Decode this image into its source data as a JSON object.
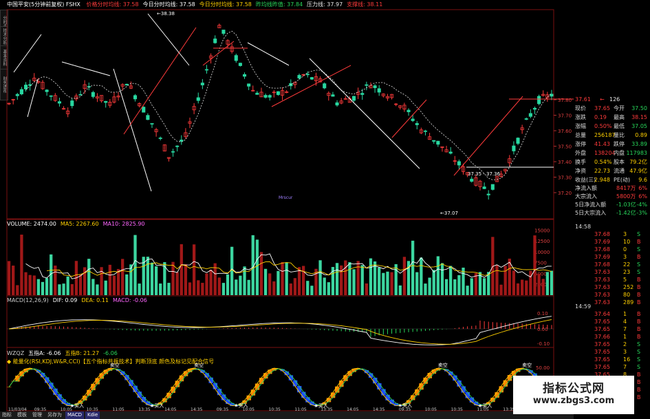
{
  "header": {
    "title": "中国平安(5分钟前复权) FSHX",
    "items": [
      {
        "label": "价格分时均线:",
        "value": "37.58",
        "color": "#ff3b3b"
      },
      {
        "label": "今日分时均线:",
        "value": "37.58",
        "color": "#ffffff"
      },
      {
        "label": "今日分时均线:",
        "value": "37.58",
        "color": "#ffd000"
      },
      {
        "label": "昨均线昨值:",
        "value": "37.84",
        "color": "#28d75a"
      },
      {
        "label": "压力线:",
        "value": "37.97",
        "color": "#e8e8e8"
      },
      {
        "label": "支撑线:",
        "value": "38.11",
        "color": "#ff3b3b"
      }
    ]
  },
  "left_tabs": [
    "分时走势",
    "技术分析",
    "基本资料",
    "财务透视"
  ],
  "price_chart": {
    "y_ticks": [
      "37.80",
      "37.70",
      "37.60",
      "37.50",
      "37.40",
      "37.30",
      "37.20"
    ],
    "high_label": "38.38",
    "low_label": "37.07",
    "range_label": "37.35 - 37.36",
    "marker_label": "Mrscur",
    "current_price": "37.61",
    "current_change": "126"
  },
  "volume": {
    "header": [
      {
        "text": "VOLUME: 2474.00",
        "color": "#ffffff"
      },
      {
        "text": "MA5: 2267.60",
        "color": "#ffd000"
      },
      {
        "text": "MA10: 2825.90",
        "color": "#ff66ff"
      }
    ],
    "y_ticks": [
      "15000",
      "12500",
      "10000",
      "7500",
      "5000",
      "2500"
    ]
  },
  "macd": {
    "header": [
      {
        "text": "MACD(12,26,9)",
        "color": "#cccccc"
      },
      {
        "text": "DIF: 0.09",
        "color": "#ffffff"
      },
      {
        "text": "DEA: 0.11",
        "color": "#ffd000"
      },
      {
        "text": "MACD: -0.06",
        "color": "#ff66ff"
      }
    ],
    "y_ticks": [
      "0.10",
      "0.00",
      "-0.10"
    ]
  },
  "wizqz": {
    "header": [
      {
        "text": "WZQZ",
        "color": "#cccccc"
      },
      {
        "text": "五指A: -6.06",
        "color": "#ffffff"
      },
      {
        "text": "五指B: 21.27",
        "color": "#ffd000"
      },
      {
        "text": "-6.06",
        "color": "#28d75a"
      }
    ],
    "note": "◆ 能量化(RSI,KDJ,W&R,CCI)【五个指标共振技术】判断顶底 颜色及标记见配合信号",
    "buy_label": "买入",
    "sell_label": "卖空",
    "y_ticks": [
      "50.00",
      "0.00"
    ]
  },
  "x_ticks": [
    "11/03/04",
    "09:35",
    "10:05",
    "10:35",
    "11:05",
    "13:35",
    "14:05",
    "14:35",
    "09:35",
    "10:05",
    "10:35",
    "11:05",
    "13:35",
    "14:05",
    "14:35",
    "09:35",
    "10:05",
    "10:35",
    "11:05",
    "13:35",
    "14:05"
  ],
  "quote": {
    "rows": [
      {
        "l1": "现价",
        "v1": "37.65",
        "c1": "#ff3b3b",
        "l2": "今开",
        "v2": "37.50",
        "c2": "#28d75a"
      },
      {
        "l1": "涨跌",
        "v1": "0.19",
        "c1": "#ff3b3b",
        "l2": "最高",
        "v2": "38.15",
        "c2": "#ff3b3b"
      },
      {
        "l1": "涨幅",
        "v1": "0.50%",
        "c1": "#ff3b3b",
        "l2": "最低",
        "v2": "37.05",
        "c2": "#28d75a"
      },
      {
        "l1": "总量",
        "v1": "256187",
        "c1": "#ffd000",
        "l2": "量比",
        "v2": "0.89",
        "c2": "#ffd000"
      },
      {
        "l1": "涨停",
        "v1": "41.43",
        "c1": "#ff3b3b",
        "l2": "跌停",
        "v2": "33.89",
        "c2": "#28d75a"
      },
      {
        "l1": "外盘",
        "v1": "138204",
        "c1": "#ff3b3b",
        "l2": "内盘",
        "v2": "117983",
        "c2": "#28d75a"
      },
      {
        "l1": "换手",
        "v1": "0.54%",
        "c1": "#ffd000",
        "l2": "股本",
        "v2": "79.2亿",
        "c2": "#ffd000"
      },
      {
        "l1": "净资",
        "v1": "22.73",
        "c1": "#ffd000",
        "l2": "流通",
        "v2": "47.9亿",
        "c2": "#ffd000"
      },
      {
        "l1": "收益(三)",
        "v1": "2.948",
        "c1": "#ffd000",
        "l2": "PE(动)",
        "v2": "9.6",
        "c2": "#ffd000"
      }
    ],
    "flows": [
      {
        "label": "净流入额",
        "value": "8417万",
        "pct": "6%",
        "color": "#ff3b3b"
      },
      {
        "label": "大宗流入",
        "value": "5800万",
        "pct": "6%",
        "color": "#ff3b3b"
      },
      {
        "label": "5日净流入额",
        "value": "-1.03亿",
        "pct": "-4%",
        "color": "#28d75a"
      },
      {
        "label": "5日大宗流入",
        "value": "-1.42亿",
        "pct": "-3%",
        "color": "#28d75a"
      }
    ]
  },
  "ticks1": {
    "time": "14:58",
    "rows": [
      {
        "p": "37.68",
        "v": "3",
        "s": "S"
      },
      {
        "p": "37.69",
        "v": "10",
        "s": "B"
      },
      {
        "p": "37.68",
        "v": "0",
        "s": "S"
      },
      {
        "p": "37.69",
        "v": "3",
        "s": "B"
      },
      {
        "p": "37.68",
        "v": "22",
        "s": "S"
      },
      {
        "p": "37.63",
        "v": "23",
        "s": "S"
      },
      {
        "p": "37.63",
        "v": "5",
        "s": "B"
      },
      {
        "p": "37.63",
        "v": "252",
        "s": "B"
      },
      {
        "p": "37.63",
        "v": "80",
        "s": "B"
      },
      {
        "p": "37.63",
        "v": "289",
        "s": "B"
      }
    ]
  },
  "ticks2": {
    "time": "14:59",
    "rows": [
      {
        "p": "37.64",
        "v": "1",
        "s": "B"
      },
      {
        "p": "37.65",
        "v": "4",
        "s": "B"
      },
      {
        "p": "37.65",
        "v": "7",
        "s": "B"
      },
      {
        "p": "37.66",
        "v": "1",
        "s": "B"
      },
      {
        "p": "37.65",
        "v": "2",
        "s": "S"
      },
      {
        "p": "37.65",
        "v": "3",
        "s": "S"
      },
      {
        "p": "37.65",
        "v": "16",
        "s": "S"
      },
      {
        "p": "37.65",
        "v": "7",
        "s": "S"
      },
      {
        "p": "37.65",
        "v": "8",
        "s": "B"
      },
      {
        "p": "37.65",
        "v": "10",
        "s": "B"
      },
      {
        "p": "37.65",
        "v": "4",
        "s": "B"
      },
      {
        "p": "37.65",
        "v": "5",
        "s": "B"
      }
    ]
  },
  "tabs": [
    "指标",
    "模板",
    "管理",
    "另存为",
    "MACD",
    "Kdie"
  ],
  "watermark": {
    "title": "指标公式网",
    "url": "www.zbgs3.com"
  },
  "colors": {
    "up": "#ff3b3b",
    "down": "#28d7a0",
    "grid": "#7a1010"
  }
}
